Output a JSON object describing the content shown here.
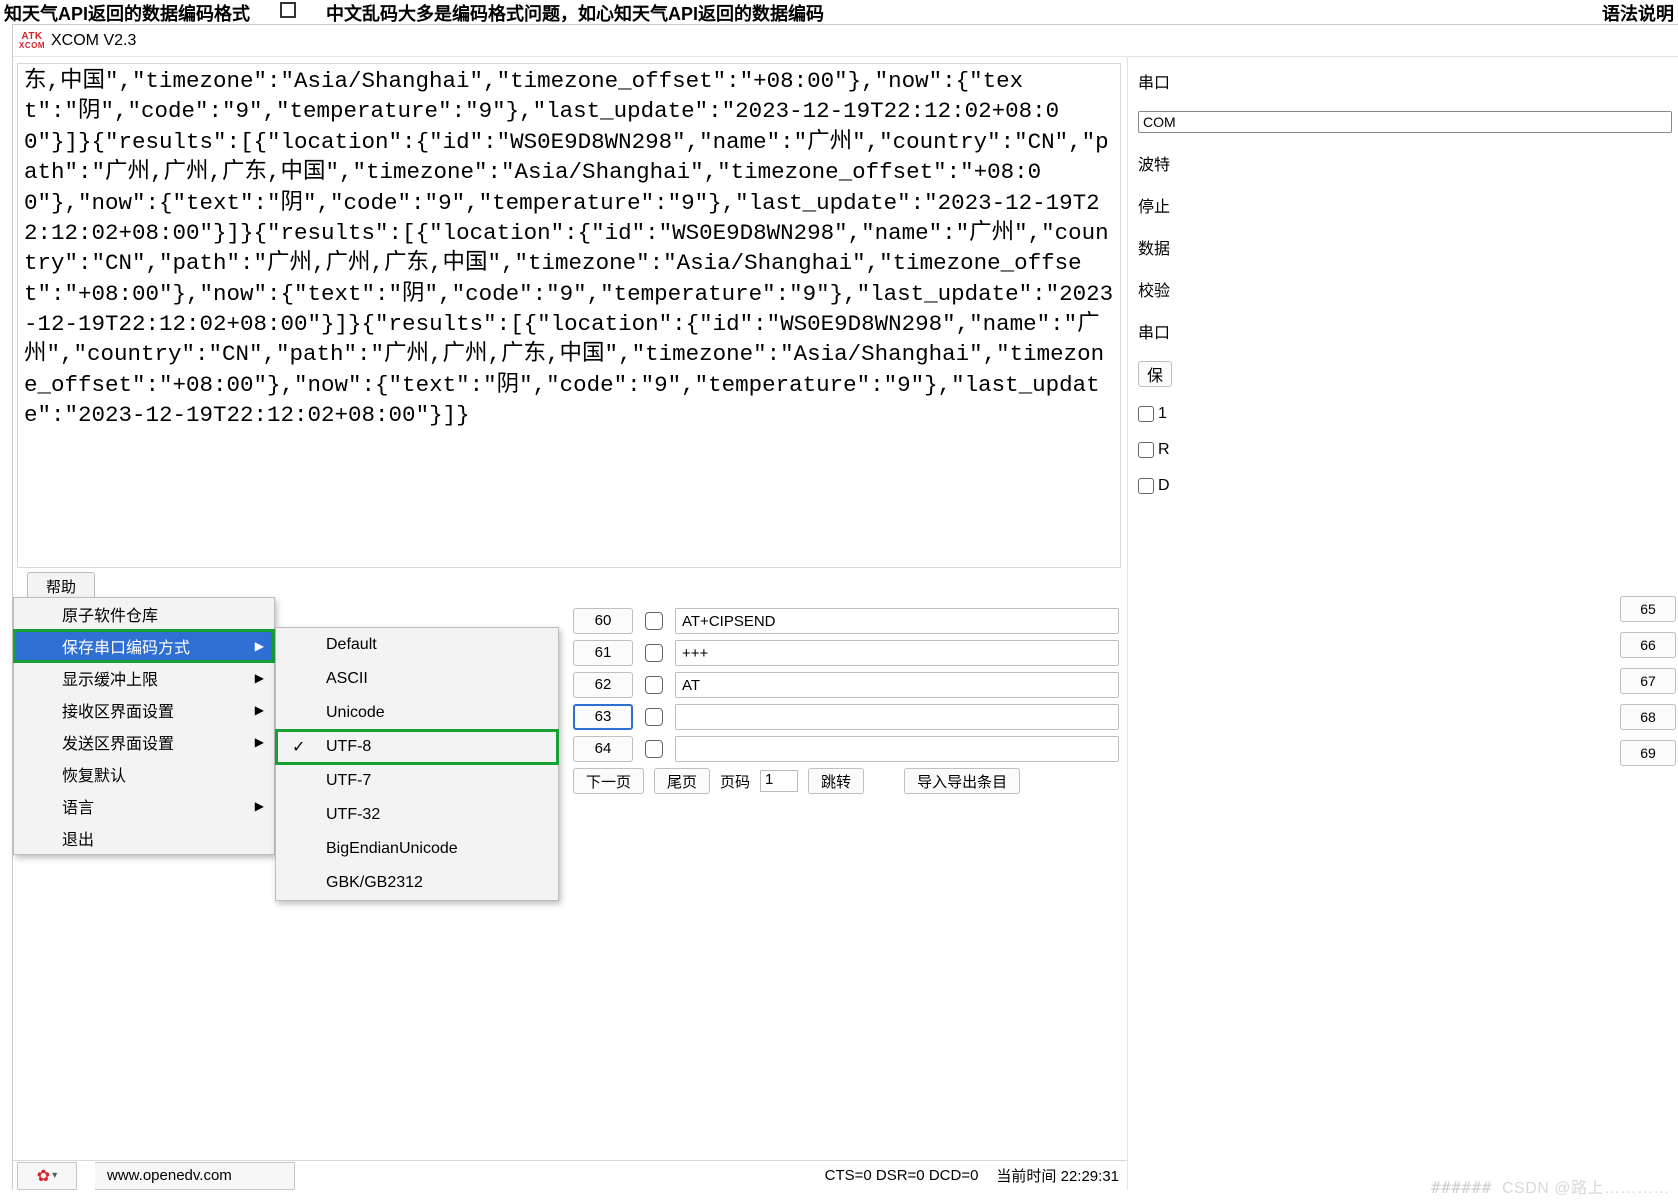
{
  "topstrip": {
    "frag1": "知天气API返回的数据编码格式",
    "frag2": "中文乱码大多是编码格式问题，如心知天气API返回的数据编码",
    "rightlabel": "语法说明"
  },
  "app": {
    "title": "XCOM V2.3",
    "logo_top": "ATK",
    "logo_bottom": "XCOM"
  },
  "receive_text": "东,中国\",\"timezone\":\"Asia/Shanghai\",\"timezone_offset\":\"+08:00\"},\"now\":{\"text\":\"阴\",\"code\":\"9\",\"temperature\":\"9\"},\"last_update\":\"2023-12-19T22:12:02+08:00\"}]}{\"results\":[{\"location\":{\"id\":\"WS0E9D8WN298\",\"name\":\"广州\",\"country\":\"CN\",\"path\":\"广州,广州,广东,中国\",\"timezone\":\"Asia/Shanghai\",\"timezone_offset\":\"+08:00\"},\"now\":{\"text\":\"阴\",\"code\":\"9\",\"temperature\":\"9\"},\"last_update\":\"2023-12-19T22:12:02+08:00\"}]}{\"results\":[{\"location\":{\"id\":\"WS0E9D8WN298\",\"name\":\"广州\",\"country\":\"CN\",\"path\":\"广州,广州,广东,中国\",\"timezone\":\"Asia/Shanghai\",\"timezone_offset\":\"+08:00\"},\"now\":{\"text\":\"阴\",\"code\":\"9\",\"temperature\":\"9\"},\"last_update\":\"2023-12-19T22:12:02+08:00\"}]}{\"results\":[{\"location\":{\"id\":\"WS0E9D8WN298\",\"name\":\"广州\",\"country\":\"CN\",\"path\":\"广州,广州,广东,中国\",\"timezone\":\"Asia/Shanghai\",\"timezone_offset\":\"+08:00\"},\"now\":{\"text\":\"阴\",\"code\":\"9\",\"temperature\":\"9\"},\"last_update\":\"2023-12-19T22:12:02+08:00\"}]}",
  "tabs": {
    "help": "帮助"
  },
  "ctx_menu": {
    "items": [
      {
        "label": "原子软件仓库",
        "sub": false
      },
      {
        "label": "保存串口编码方式",
        "sub": true,
        "hl": true
      },
      {
        "label": "显示缓冲上限",
        "sub": true
      },
      {
        "label": "接收区界面设置",
        "sub": true
      },
      {
        "label": "发送区界面设置",
        "sub": true
      },
      {
        "label": "恢复默认",
        "sub": false
      },
      {
        "label": "语言",
        "sub": true
      },
      {
        "label": "退出",
        "sub": false
      }
    ]
  },
  "encoding_submenu": {
    "items": [
      "Default",
      "ASCII",
      "Unicode",
      "UTF-8",
      "UTF-7",
      "UTF-32",
      "BigEndianUnicode",
      "GBK/GB2312"
    ],
    "checked": "UTF-8",
    "highlighted": "UTF-8"
  },
  "send_rows": [
    {
      "n": "60",
      "txt": "AT+CIPSEND",
      "rn": "65"
    },
    {
      "n": "61",
      "txt": "+++",
      "rn": "66"
    },
    {
      "n": "62",
      "txt": "AT",
      "rn": "67"
    },
    {
      "n": "63",
      "txt": "",
      "rn": "68",
      "active": true
    },
    {
      "n": "64",
      "txt": "",
      "rn": "69"
    }
  ],
  "pager": {
    "next": "下一页",
    "last": "尾页",
    "page_label": "页码",
    "page_value": "1",
    "jump": "跳转",
    "importexport": "导入导出条目"
  },
  "statusbar": {
    "url": "www.openedv.com",
    "signals": "CTS=0 DSR=0 DCD=0",
    "time_label": "当前时间",
    "time_value": "22:29:31"
  },
  "right_panel": {
    "labels": [
      "串口",
      "波特",
      "停止",
      "数据",
      "校验",
      "串口"
    ],
    "com": "COM",
    "save_btn": "保",
    "chk1": "1",
    "chkR": "R",
    "chkD": "D"
  },
  "watermark": {
    "hashes": "###### ",
    "text": "CSDN @路上…………"
  }
}
